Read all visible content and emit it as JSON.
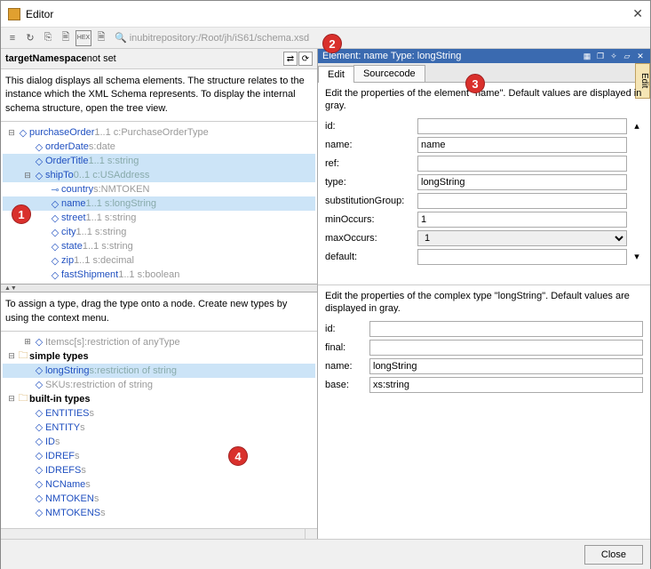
{
  "window": {
    "title": "Editor",
    "close_button": "Close"
  },
  "toolbar": {
    "path": "inubitrepository:/Root/jh/iS61/schema.xsd"
  },
  "left": {
    "header": {
      "bold": "targetNamespace",
      "rest": " not set"
    },
    "info": "This dialog displays all schema elements. The structure relates to the instance which the XML Schema represents. To display the internal schema structure, open the tree view.",
    "tree": [
      {
        "indent": 0,
        "exp": "⊟",
        "kind": "elem",
        "label": "purchaseOrder",
        "suffix": "1..1 c:PurchaseOrderType",
        "sel": false
      },
      {
        "indent": 1,
        "exp": "",
        "kind": "elem",
        "label": "orderDate",
        "suffix": "s:date",
        "sel": false
      },
      {
        "indent": 1,
        "exp": "",
        "kind": "elem",
        "label": "OrderTitle",
        "suffix": "1..1 s:string",
        "sel": true
      },
      {
        "indent": 1,
        "exp": "⊟",
        "kind": "elem",
        "label": "shipTo",
        "suffix": "0..1 c:USAddress",
        "sel": true
      },
      {
        "indent": 2,
        "exp": "",
        "kind": "attr",
        "label": "country",
        "suffix": "s:NMTOKEN",
        "sel": false
      },
      {
        "indent": 2,
        "exp": "",
        "kind": "elem",
        "label": "name",
        "suffix": "1..1 s:longString",
        "sel": true
      },
      {
        "indent": 2,
        "exp": "",
        "kind": "elem",
        "label": "street",
        "suffix": "1..1 s:string",
        "sel": false
      },
      {
        "indent": 2,
        "exp": "",
        "kind": "elem",
        "label": "city",
        "suffix": "1..1 s:string",
        "sel": false
      },
      {
        "indent": 2,
        "exp": "",
        "kind": "elem",
        "label": "state",
        "suffix": "1..1 s:string",
        "sel": false
      },
      {
        "indent": 2,
        "exp": "",
        "kind": "elem",
        "label": "zip",
        "suffix": "1..1 s:decimal",
        "sel": false
      },
      {
        "indent": 2,
        "exp": "",
        "kind": "elem",
        "label": "fastShipment",
        "suffix": "1..1 s:boolean",
        "sel": false
      }
    ],
    "info2": "To assign a type, drag the type onto a node. Create new types by using the context menu.",
    "tree2": [
      {
        "indent": 1,
        "exp": "⊞",
        "kind": "elem",
        "label": "Items",
        "suffix": "c[s]:restriction of anyType",
        "sel": false,
        "grayLabel": true
      },
      {
        "indent": 0,
        "exp": "⊟",
        "kind": "folder",
        "label": "simple types",
        "suffix": "",
        "sel": false,
        "bold": true
      },
      {
        "indent": 1,
        "exp": "",
        "kind": "elem",
        "label": "longString",
        "suffix": "s:restriction of string",
        "sel": true
      },
      {
        "indent": 1,
        "exp": "",
        "kind": "elem",
        "label": "SKU",
        "suffix": "s:restriction of string",
        "sel": false,
        "grayLabel": true
      },
      {
        "indent": 0,
        "exp": "⊟",
        "kind": "folder",
        "label": "built-in types",
        "suffix": "",
        "sel": false,
        "bold": true
      },
      {
        "indent": 1,
        "exp": "",
        "kind": "elem",
        "label": "ENTITIES",
        "suffix": "s",
        "sel": false
      },
      {
        "indent": 1,
        "exp": "",
        "kind": "elem",
        "label": "ENTITY",
        "suffix": "s",
        "sel": false
      },
      {
        "indent": 1,
        "exp": "",
        "kind": "elem",
        "label": "ID",
        "suffix": "s",
        "sel": false
      },
      {
        "indent": 1,
        "exp": "",
        "kind": "elem",
        "label": "IDREF",
        "suffix": "s",
        "sel": false
      },
      {
        "indent": 1,
        "exp": "",
        "kind": "elem",
        "label": "IDREFS",
        "suffix": "s",
        "sel": false
      },
      {
        "indent": 1,
        "exp": "",
        "kind": "elem",
        "label": "NCName",
        "suffix": "s",
        "sel": false
      },
      {
        "indent": 1,
        "exp": "",
        "kind": "elem",
        "label": "NMTOKEN",
        "suffix": "s",
        "sel": false
      },
      {
        "indent": 1,
        "exp": "",
        "kind": "elem",
        "label": "NMTOKENS",
        "suffix": "s",
        "sel": false
      }
    ]
  },
  "right": {
    "header": "Element: name  Type: longString",
    "tabs": {
      "edit": "Edit",
      "sourcecode": "Sourcecode"
    },
    "side_tab": "Edit",
    "desc1": "Edit the properties of the element \"name\". Default values are displayed in gray.",
    "fields1": {
      "id_label": "id:",
      "id": "",
      "name_label": "name:",
      "name": "name",
      "ref_label": "ref:",
      "ref": "",
      "type_label": "type:",
      "type": "longString",
      "subst_label": "substitutionGroup:",
      "subst": "",
      "min_label": "minOccurs:",
      "min": "1",
      "max_label": "maxOccurs:",
      "max": "1",
      "default_label": "default:",
      "default": ""
    },
    "desc2": "Edit the properties of the complex type \"longString\". Default values are displayed in gray.",
    "fields2": {
      "id_label": "id:",
      "id": "",
      "final_label": "final:",
      "final": "",
      "name_label": "name:",
      "name": "longString",
      "base_label": "base:",
      "base": "xs:string"
    }
  },
  "markers": {
    "1": "1",
    "2": "2",
    "3": "3",
    "4": "4"
  }
}
